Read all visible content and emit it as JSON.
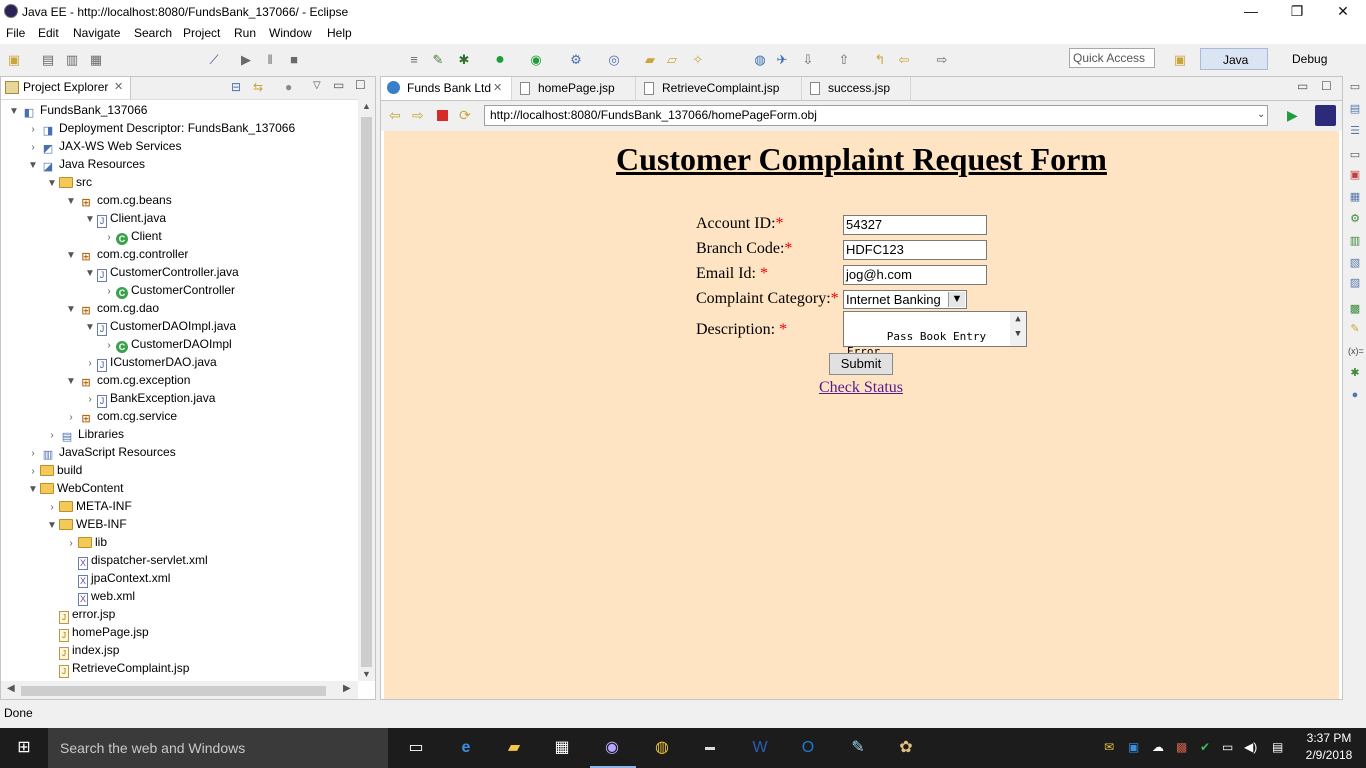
{
  "window": {
    "title": "Java EE - http://localhost:8080/FundsBank_137066/ - Eclipse",
    "minimize_glyph": "—",
    "restore_glyph": "❐",
    "close_glyph": "✕"
  },
  "menubar": [
    "File",
    "Edit",
    "Navigate",
    "Search",
    "Project",
    "Run",
    "Window",
    "Help"
  ],
  "toolbar": {
    "quick_access_placeholder": "Quick Access",
    "perspectives": [
      "Java EE",
      "Debug"
    ]
  },
  "project_explorer": {
    "title": "Project Explorer",
    "tree": [
      {
        "label": "FundsBank_137066",
        "icon": "project-icon",
        "toggle": "▼"
      },
      {
        "label": "Deployment Descriptor: FundsBank_137066",
        "icon": "descriptor-icon",
        "toggle": "›"
      },
      {
        "label": "JAX-WS Web Services",
        "icon": "webservice-icon",
        "toggle": "›"
      },
      {
        "label": "Java Resources",
        "icon": "java-resources-icon",
        "toggle": "▼"
      },
      {
        "label": "src",
        "icon": "source-folder-icon",
        "toggle": "▼"
      },
      {
        "label": "com.cg.beans",
        "icon": "package-icon",
        "toggle": "▼"
      },
      {
        "label": "Client.java",
        "icon": "java-file-icon",
        "toggle": "▼"
      },
      {
        "label": "Client",
        "icon": "class-icon",
        "toggle": "›"
      },
      {
        "label": "com.cg.controller",
        "icon": "package-icon",
        "toggle": "▼"
      },
      {
        "label": "CustomerController.java",
        "icon": "java-file-icon",
        "toggle": "▼"
      },
      {
        "label": "CustomerController",
        "icon": "class-icon",
        "toggle": "›"
      },
      {
        "label": "com.cg.dao",
        "icon": "package-icon",
        "toggle": "▼"
      },
      {
        "label": "CustomerDAOImpl.java",
        "icon": "java-file-icon",
        "toggle": "▼"
      },
      {
        "label": "CustomerDAOImpl",
        "icon": "class-icon",
        "toggle": "›"
      },
      {
        "label": "ICustomerDAO.java",
        "icon": "java-file-icon",
        "toggle": "›"
      },
      {
        "label": "com.cg.exception",
        "icon": "package-icon",
        "toggle": "▼"
      },
      {
        "label": "BankException.java",
        "icon": "java-file-icon",
        "toggle": "›"
      },
      {
        "label": "com.cg.service",
        "icon": "package-icon",
        "toggle": "›"
      },
      {
        "label": "Libraries",
        "icon": "libraries-icon",
        "toggle": "›"
      },
      {
        "label": "JavaScript Resources",
        "icon": "js-resources-icon",
        "toggle": "›"
      },
      {
        "label": "build",
        "icon": "folder-icon",
        "toggle": "›"
      },
      {
        "label": "WebContent",
        "icon": "folder-icon",
        "toggle": "▼"
      },
      {
        "label": "META-INF",
        "icon": "folder-icon",
        "toggle": "›"
      },
      {
        "label": "WEB-INF",
        "icon": "folder-icon",
        "toggle": "▼"
      },
      {
        "label": "lib",
        "icon": "folder-icon",
        "toggle": "›"
      },
      {
        "label": "dispatcher-servlet.xml",
        "icon": "xml-file-icon",
        "toggle": ""
      },
      {
        "label": "jpaContext.xml",
        "icon": "xml-file-icon",
        "toggle": ""
      },
      {
        "label": "web.xml",
        "icon": "xml-file-icon",
        "toggle": ""
      },
      {
        "label": "error.jsp",
        "icon": "jsp-file-icon",
        "toggle": ""
      },
      {
        "label": "homePage.jsp",
        "icon": "jsp-file-icon",
        "toggle": ""
      },
      {
        "label": "index.jsp",
        "icon": "jsp-file-icon",
        "toggle": ""
      },
      {
        "label": "RetrieveComplaint.jsp",
        "icon": "jsp-file-icon",
        "toggle": ""
      }
    ]
  },
  "editor": {
    "tabs": [
      {
        "label": "Funds Bank Ltd",
        "icon": "browser-icon",
        "active": true,
        "close": "✕"
      },
      {
        "label": "homePage.jsp",
        "icon": "jsp-file-icon",
        "active": false
      },
      {
        "label": "RetrieveComplaint.jsp",
        "icon": "jsp-file-icon",
        "active": false
      },
      {
        "label": "success.jsp",
        "icon": "jsp-file-icon",
        "active": false
      }
    ],
    "url": "http://localhost:8080/FundsBank_137066/homePageForm.obj"
  },
  "form": {
    "heading": "Customer Complaint Request Form",
    "account_label": "Account ID:",
    "account_value": "54327",
    "branch_label": "Branch Code:",
    "branch_value": "HDFC123",
    "email_label": "Email Id: ",
    "email_value": "jog@h.com",
    "category_label": "Complaint Category:",
    "category_value": "Internet Banking",
    "description_label": "Description: ",
    "description_value": "Pass Book Entry\nError.",
    "required_mark": "*",
    "submit_label": "Submit",
    "check_status_link": "Check Status"
  },
  "status_bar": {
    "text": "Done"
  },
  "taskbar": {
    "search_placeholder": "Search the web and Windows",
    "time": "3:37 PM",
    "date": "2/9/2018"
  },
  "colors": {
    "page_background": "#ffe4c4",
    "required_star": "#ee0000",
    "link": "#551a8b",
    "taskbar": "#1c1c1c"
  }
}
